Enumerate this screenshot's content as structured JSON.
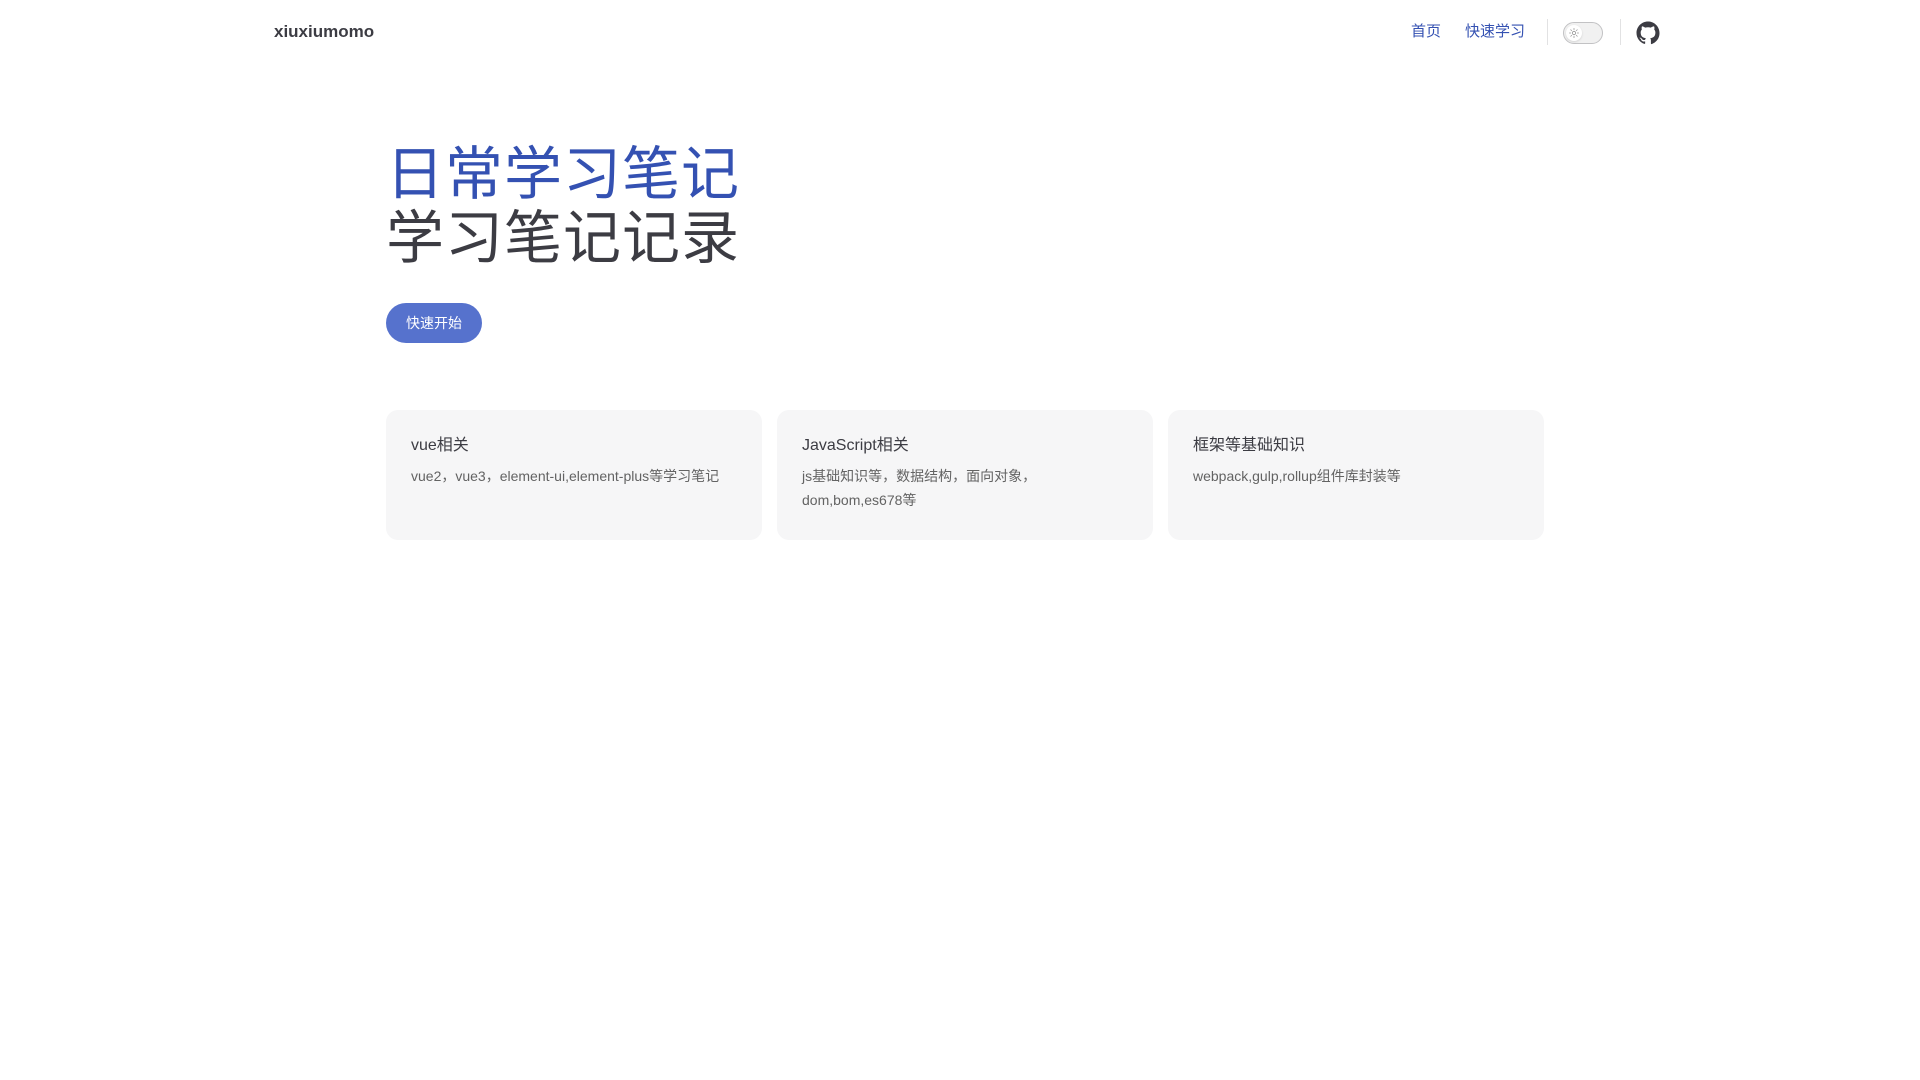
{
  "nav": {
    "site_title": "xiuxiumomo",
    "links": [
      {
        "label": "首页"
      },
      {
        "label": "快速学习"
      }
    ],
    "theme_toggle_icon": "sun-icon",
    "github_icon": "github-icon"
  },
  "hero": {
    "name": "日常学习笔记",
    "text": "学习笔记记录",
    "action_label": "快速开始"
  },
  "features": [
    {
      "title": "vue相关",
      "details": "vue2，vue3，element-ui,element-plus等学习笔记"
    },
    {
      "title": "JavaScript相关",
      "details": "js基础知识等，数据结构，面向对象，dom,bom,es678等"
    },
    {
      "title": "框架等基础知识",
      "details": "webpack,gulp,rollup组件库封装等"
    }
  ],
  "colors": {
    "brand": "#3451b2",
    "button": "#5672cd",
    "card_bg": "#f6f6f7",
    "text": "#3c3c43"
  }
}
